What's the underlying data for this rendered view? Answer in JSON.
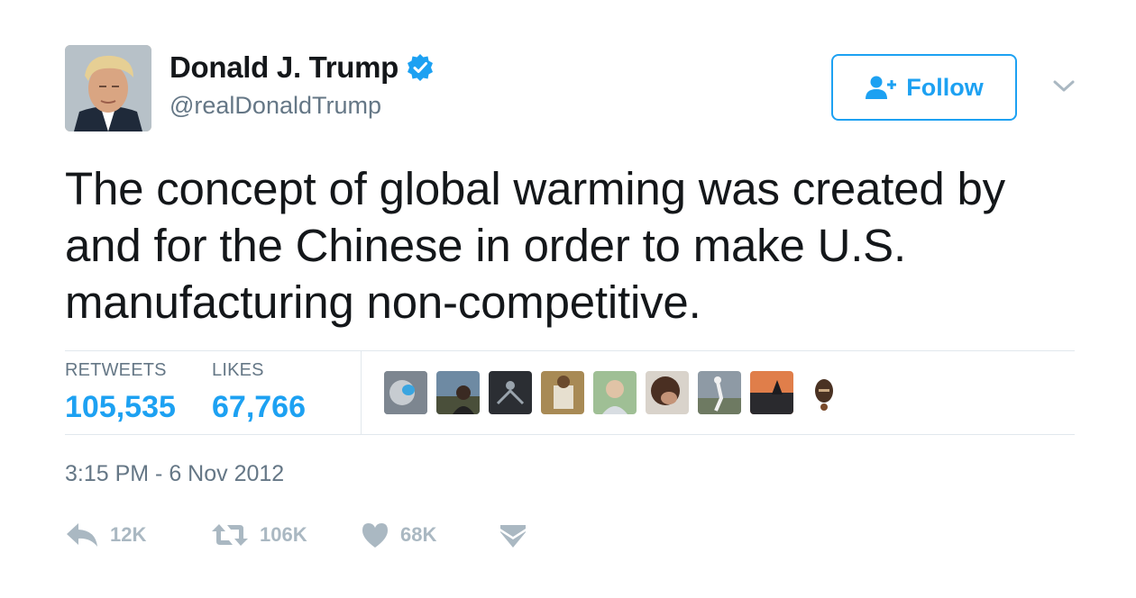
{
  "author": {
    "name": "Donald J. Trump",
    "handle": "@realDonaldTrump",
    "verified": true,
    "avatar_icon": "profile-photo"
  },
  "follow_button": {
    "label": "Follow",
    "icon": "add-user-icon"
  },
  "tweet": {
    "text": "The concept of global warming was created by and for the Chinese in order to make U.S. manufacturing non-competitive."
  },
  "stats": {
    "retweets_label": "RETWEETS",
    "retweets_value": "105,535",
    "likes_label": "LIKES",
    "likes_value": "67,766"
  },
  "likers": [
    {
      "icon": "liker-avatar-1"
    },
    {
      "icon": "liker-avatar-2"
    },
    {
      "icon": "liker-avatar-3"
    },
    {
      "icon": "liker-avatar-4"
    },
    {
      "icon": "liker-avatar-5"
    },
    {
      "icon": "liker-avatar-6"
    },
    {
      "icon": "liker-avatar-7"
    },
    {
      "icon": "liker-avatar-8"
    },
    {
      "icon": "liker-avatar-9"
    }
  ],
  "timestamp": "3:15 PM - 6 Nov 2012",
  "actions": {
    "reply_count": "12K",
    "retweet_count": "106K",
    "like_count": "68K"
  },
  "colors": {
    "accent": "#1da1f2",
    "muted": "#657786",
    "action_gray": "#aab8c2",
    "text": "#14171a"
  }
}
